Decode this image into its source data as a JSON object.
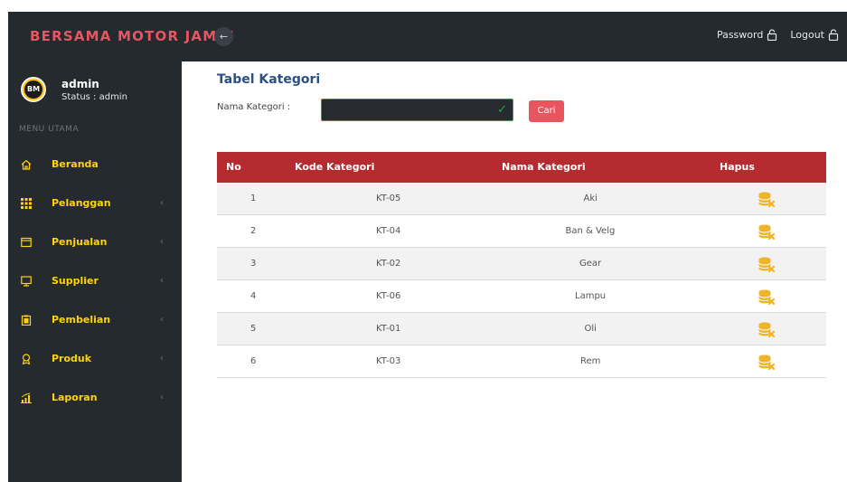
{
  "header": {
    "brand": "BERSAMA MOTOR JAMBI",
    "toggle_icon": "arrow-left",
    "password_label": "Password",
    "logout_label": "Logout"
  },
  "user": {
    "avatar_text": "BM",
    "name": "admin",
    "status": "Status : admin"
  },
  "sidebar": {
    "header": "MENU UTAMA",
    "items": [
      {
        "label": "Beranda",
        "icon": "home-icon",
        "has_caret": false
      },
      {
        "label": "Pelanggan",
        "icon": "grid-icon",
        "has_caret": true
      },
      {
        "label": "Penjualan",
        "icon": "window-icon",
        "has_caret": true
      },
      {
        "label": "Supplier",
        "icon": "monitor-icon",
        "has_caret": true
      },
      {
        "label": "Pembelian",
        "icon": "clipboard-icon",
        "has_caret": true
      },
      {
        "label": "Produk",
        "icon": "award-icon",
        "has_caret": true
      },
      {
        "label": "Laporan",
        "icon": "chart-icon",
        "has_caret": true
      }
    ],
    "caret": "‹"
  },
  "main": {
    "title": "Tabel Kategori",
    "search_label": "Nama Kategori :",
    "search_value": "",
    "search_button": "Cari"
  },
  "table": {
    "columns": [
      "No",
      "Kode Kategori",
      "Nama Kategori",
      "Hapus"
    ],
    "rows": [
      {
        "no": "1",
        "kode": "KT-05",
        "nama": "Aki"
      },
      {
        "no": "2",
        "kode": "KT-04",
        "nama": "Ban & Velg"
      },
      {
        "no": "3",
        "kode": "KT-02",
        "nama": "Gear"
      },
      {
        "no": "4",
        "kode": "KT-06",
        "nama": "Lampu"
      },
      {
        "no": "5",
        "kode": "KT-01",
        "nama": "Oli"
      },
      {
        "no": "6",
        "kode": "KT-03",
        "nama": "Rem"
      }
    ]
  },
  "colors": {
    "brand": "#e85562",
    "sidebar_bg": "#252a2f",
    "menu_text": "#ffd30a",
    "table_header": "#b52b30",
    "title": "#2c4f86",
    "delete_icon": "#f0b429"
  }
}
